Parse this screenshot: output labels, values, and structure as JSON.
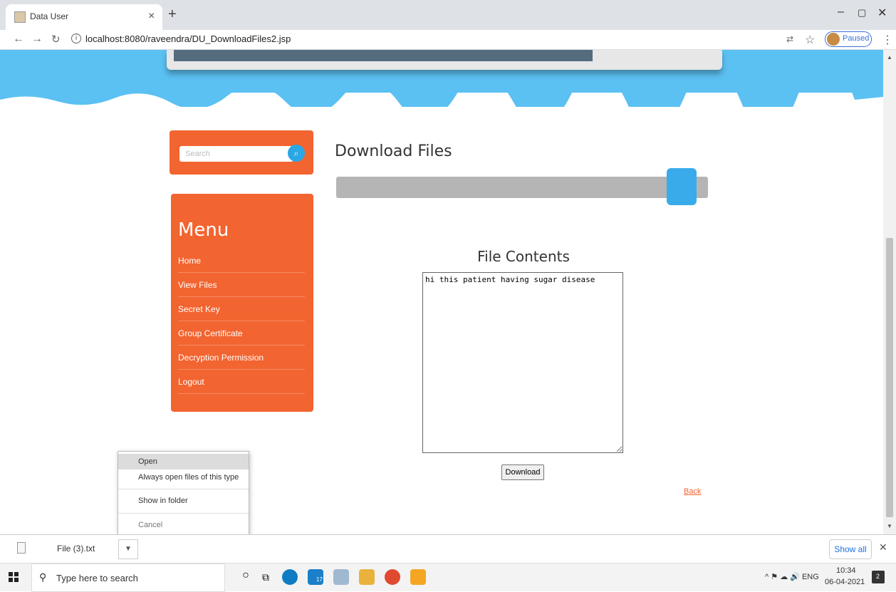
{
  "browser": {
    "tab_title": "Data User",
    "url": "localhost:8080/raveendra/DU_DownloadFiles2.jsp",
    "paused_label": "Paused"
  },
  "sidebar": {
    "search_placeholder": "Search",
    "menu_title": "Menu",
    "items": [
      {
        "label": "Home"
      },
      {
        "label": "View Files"
      },
      {
        "label": "Secret Key"
      },
      {
        "label": "Group Certificate"
      },
      {
        "label": "Decryption Permission"
      },
      {
        "label": "Logout"
      }
    ]
  },
  "main": {
    "heading": "Download Files",
    "file_contents_heading": "File Contents",
    "file_contents": "hi this patient having sugar disease",
    "download_label": "Download",
    "back_label": "Back"
  },
  "context_menu": {
    "items": [
      {
        "label": "Open"
      },
      {
        "label": "Always open files of this type"
      },
      {
        "label": "Show in folder"
      },
      {
        "label": "Cancel"
      }
    ]
  },
  "download_bar": {
    "file_name": "File (3).txt",
    "show_all_label": "Show all"
  },
  "taskbar": {
    "search_placeholder": "Type here to search",
    "lang": "ENG",
    "time": "10:34",
    "date": "06-04-2021",
    "notification_count": "2",
    "badge_count": "17"
  },
  "colors": {
    "accent_orange": "#f26430",
    "sky_blue": "#5bc0f2",
    "link_blue": "#1a73e8"
  }
}
